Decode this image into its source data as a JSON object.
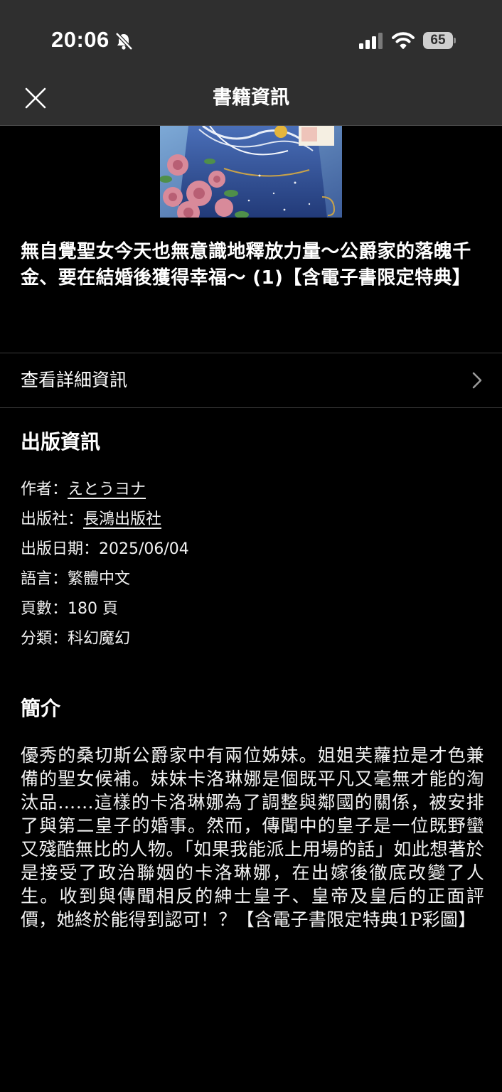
{
  "status_bar": {
    "time": "20:06",
    "battery": "65",
    "icons": [
      "bell-slash-icon",
      "cellular-signal-icon",
      "wifi-icon",
      "battery-icon"
    ]
  },
  "nav": {
    "title": "書籍資訊",
    "close_icon": "close-icon"
  },
  "book": {
    "title": "無自覺聖女今天也無意識地釋放力量～公爵家的落魄千金、要在結婚後獲得幸福～ (1)【含電子書限定特典】"
  },
  "details_link": {
    "label": "查看詳細資訊",
    "icon": "chevron-right-icon"
  },
  "publication": {
    "heading": "出版資訊",
    "author_label": "作者：",
    "author": "えとうヨナ",
    "publisher_label": "出版社：",
    "publisher": "長鴻出版社",
    "date_line": "出版日期：2025/06/04",
    "language_line": "語言：繁體中文",
    "pages_line": "頁數：180 頁",
    "category_line": "分類：科幻魔幻"
  },
  "synopsis": {
    "heading": "簡介",
    "text": "優秀的桑切斯公爵家中有兩位姊妹。姐姐芙蘿拉是才色兼備的聖女候補。妹妹卡洛琳娜是個既平凡又毫無才能的淘汰品……這樣的卡洛琳娜為了調整與鄰國的關係，被安排了與第二皇子的婚事。然而，傳聞中的皇子是一位既野蠻又殘酷無比的人物。「如果我能派上用場的話」如此想著於是接受了政治聯姻的卡洛琳娜，在出嫁後徹底改變了人生。收到與傳聞相反的紳士皇子、皇帝及皇后的正面評價，她終於能得到認可！？【含電子書限定特典1P彩圖】"
  },
  "colors": {
    "background": "#000000",
    "bar": "#2f2f2f",
    "text": "#ffffff",
    "divider": "#3a3a3a"
  }
}
